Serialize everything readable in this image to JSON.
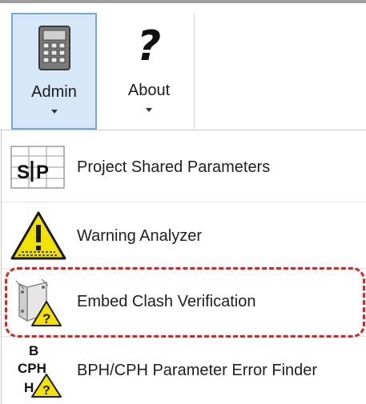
{
  "ribbon": {
    "buttons": [
      {
        "label": "Admin",
        "icon": "calculator-icon",
        "selected": true
      },
      {
        "label": "About",
        "icon": "question-mark-icon",
        "glyph": "?",
        "selected": false
      }
    ]
  },
  "menu": {
    "items": [
      {
        "label": "Project Shared Parameters",
        "icon": "shared-parameters-icon",
        "icon_text": [
          "S",
          "P"
        ]
      },
      {
        "label": "Warning Analyzer",
        "icon": "warning-triangle-icon"
      },
      {
        "label": "Embed Clash Verification",
        "icon": "embed-clash-icon",
        "highlighted": true
      },
      {
        "label": "BPH/CPH Parameter Error Finder",
        "icon": "bph-cph-icon",
        "icon_text": [
          "B",
          "CPH",
          "H"
        ]
      }
    ]
  },
  "colors": {
    "selected_bg": "#d6e8f8",
    "selected_border": "#77a9d8",
    "highlight_dash": "#e5201f",
    "warning_yellow": "#f2e200"
  }
}
